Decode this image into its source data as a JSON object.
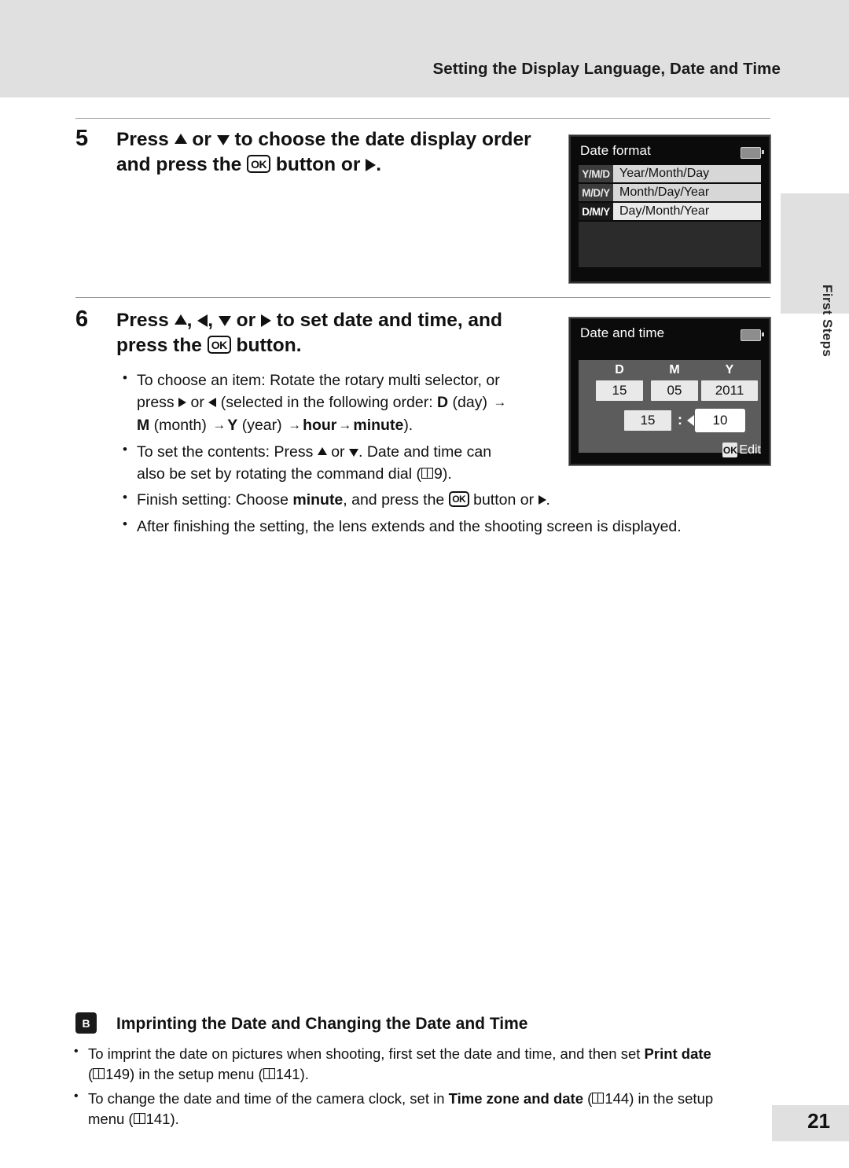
{
  "header": {
    "title": "Setting the Display Language, Date and Time"
  },
  "side_tab": {
    "label": "First Steps"
  },
  "steps": [
    {
      "number": "5",
      "line1_a": "Press ",
      "line1_b": " or ",
      "line1_c": " to choose the date display order",
      "line2_a": "and press the ",
      "line2_ok": "OK",
      "line2_b": " button or ",
      "line2_c": "."
    },
    {
      "number": "6",
      "line1_a": "Press ",
      "line1_b": ", ",
      "line1_c": ", ",
      "line1_d": " or ",
      "line1_e": " to set date and time, and",
      "line2_a": "press the ",
      "line2_ok": "OK",
      "line2_b": " button."
    }
  ],
  "step6_bullets": [
    {
      "line1": "To choose an item: Rotate the rotary multi selector, or",
      "line2_a": "press ",
      "line2_b": " or ",
      "line2_c": " (selected in the following order: ",
      "line2_d": "D",
      "line2_e": " (day) ",
      "line3_m": "M",
      "line3_month": " (month) ",
      "line3_y": "Y",
      "line3_year": " (year) ",
      "line3_hour": "hour",
      "line3_minute": "minute",
      "line3_end": ")."
    },
    {
      "line1_a": "To set the contents: Press ",
      "line1_b": " or ",
      "line1_c": ". Date and time can",
      "line2_a": "also be set by rotating the command dial (",
      "line2_ref": "9",
      "line2_b": ")."
    },
    {
      "a": "Finish setting: Choose ",
      "b": "minute",
      "c": ", and press the ",
      "ok": "OK",
      "d": " button or ",
      "e": "."
    },
    {
      "a": "After finishing the setting, the lens extends and the shooting screen is displayed."
    }
  ],
  "date_format_screen": {
    "title": "Date format",
    "battery_icon": "battery-icon",
    "rows": [
      {
        "tag": "Y/M/D",
        "label": "Year/Month/Day",
        "selected": false
      },
      {
        "tag": "M/D/Y",
        "label": "Month/Day/Year",
        "selected": false
      },
      {
        "tag": "D/M/Y",
        "label": "Day/Month/Year",
        "selected": true
      }
    ]
  },
  "date_time_screen": {
    "title": "Date and time",
    "battery_icon": "battery-icon",
    "col_labels": [
      "D",
      "M",
      "Y"
    ],
    "date_values": [
      "15",
      "05",
      "2011"
    ],
    "time_hour": "15",
    "time_colon": ":",
    "time_minute": "10",
    "edit_key": "OK",
    "edit_label": "Edit"
  },
  "note": {
    "icon_label": "B",
    "title": "Imprinting the Date and Changing the Date and Time",
    "bullets": [
      {
        "a": "To imprint the date on pictures when shooting, first set the date and time, and then set ",
        "b": "Print date",
        "c": "(",
        "ref1": "149",
        "d": ") in the setup menu (",
        "ref2": "141",
        "e": ")."
      },
      {
        "a": "To change the date and time of the camera clock, set in ",
        "b": "Time zone and date",
        "c": " (",
        "ref1": "144",
        "d": ") in the setup",
        "e": "menu (",
        "ref2": "141",
        "f": ")."
      }
    ]
  },
  "page_number": "21"
}
